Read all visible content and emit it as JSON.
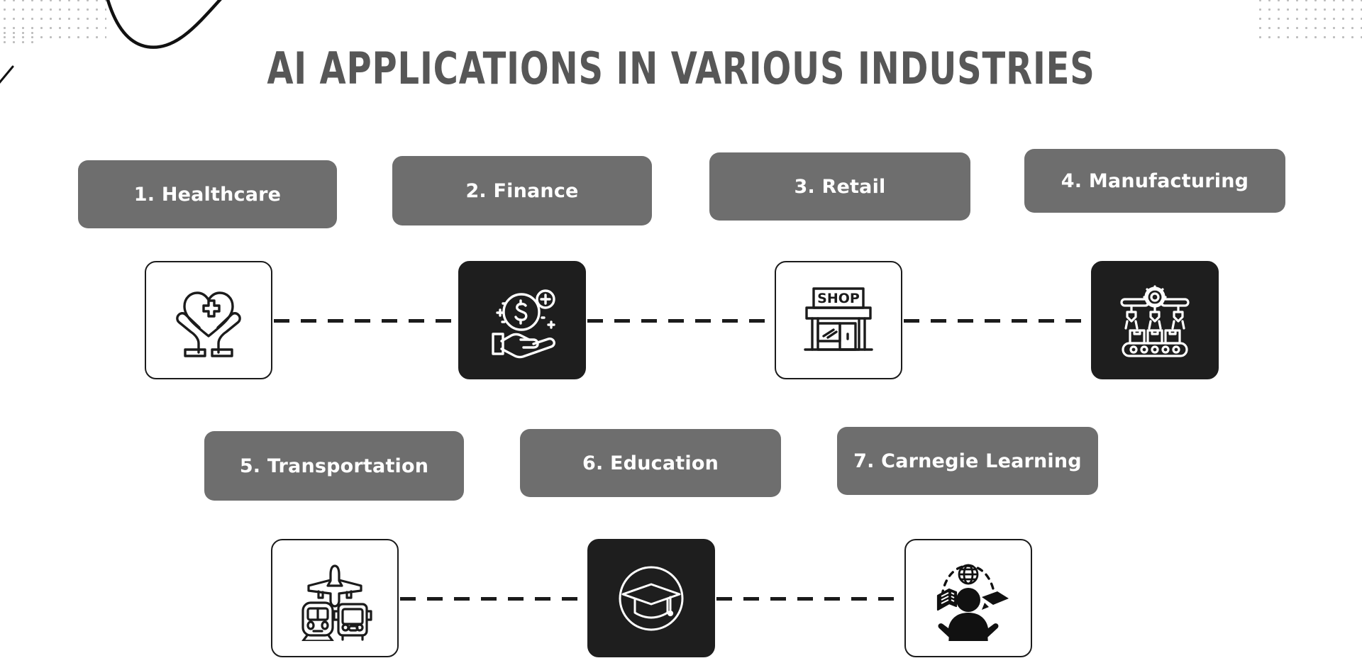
{
  "page": {
    "title": "AI APPLICATIONS IN VARIOUS INDUSTRIES",
    "background_color": "#ffffff",
    "title_color": "#575757",
    "pill_color": "#6e6e6e",
    "pill_text_color": "#ffffff",
    "dark_tile_color": "#1e1e1e",
    "light_tile_color": "#ffffff",
    "outline_color": "#1b1b1b",
    "dot_color": "#b9b9b9"
  },
  "rows": [
    {
      "name": "row-1",
      "items": [
        {
          "number": "1.",
          "label": "1. Healthcare",
          "icon": "hands-holding-heart-icon",
          "tile_style": "light"
        },
        {
          "number": "2.",
          "label": "2. Finance",
          "icon": "hand-holding-dollar-coin-icon",
          "tile_style": "dark"
        },
        {
          "number": "3.",
          "label": "3. Retail",
          "icon": "shop-storefront-icon",
          "tile_style": "light",
          "icon_text": "SHOP"
        },
        {
          "number": "4.",
          "label": "4. Manufacturing",
          "icon": "robotic-arms-conveyor-icon",
          "tile_style": "dark"
        }
      ]
    },
    {
      "name": "row-2",
      "items": [
        {
          "number": "5.",
          "label": "5. Transportation",
          "icon": "plane-train-bus-icon",
          "tile_style": "light"
        },
        {
          "number": "6.",
          "label": "6. Education",
          "icon": "graduation-cap-circle-icon",
          "tile_style": "dark"
        },
        {
          "number": "7.",
          "label": "7. Carnegie Learning",
          "icon": "person-globe-book-cap-icon",
          "tile_style": "light"
        }
      ]
    }
  ],
  "connectors": [
    {
      "name": "connector-healthcare-finance",
      "style": "dashed"
    },
    {
      "name": "connector-finance-retail",
      "style": "dashed"
    },
    {
      "name": "connector-retail-manufacturing",
      "style": "dashed"
    },
    {
      "name": "connector-transportation-education",
      "style": "dashed"
    },
    {
      "name": "connector-education-carnegie",
      "style": "dashed"
    }
  ],
  "decorations": [
    {
      "name": "dot-grid-top-left",
      "type": "dot-pattern"
    },
    {
      "name": "dot-grid-top-right",
      "type": "dot-pattern"
    },
    {
      "name": "curved-line-top-left",
      "type": "curve"
    }
  ]
}
